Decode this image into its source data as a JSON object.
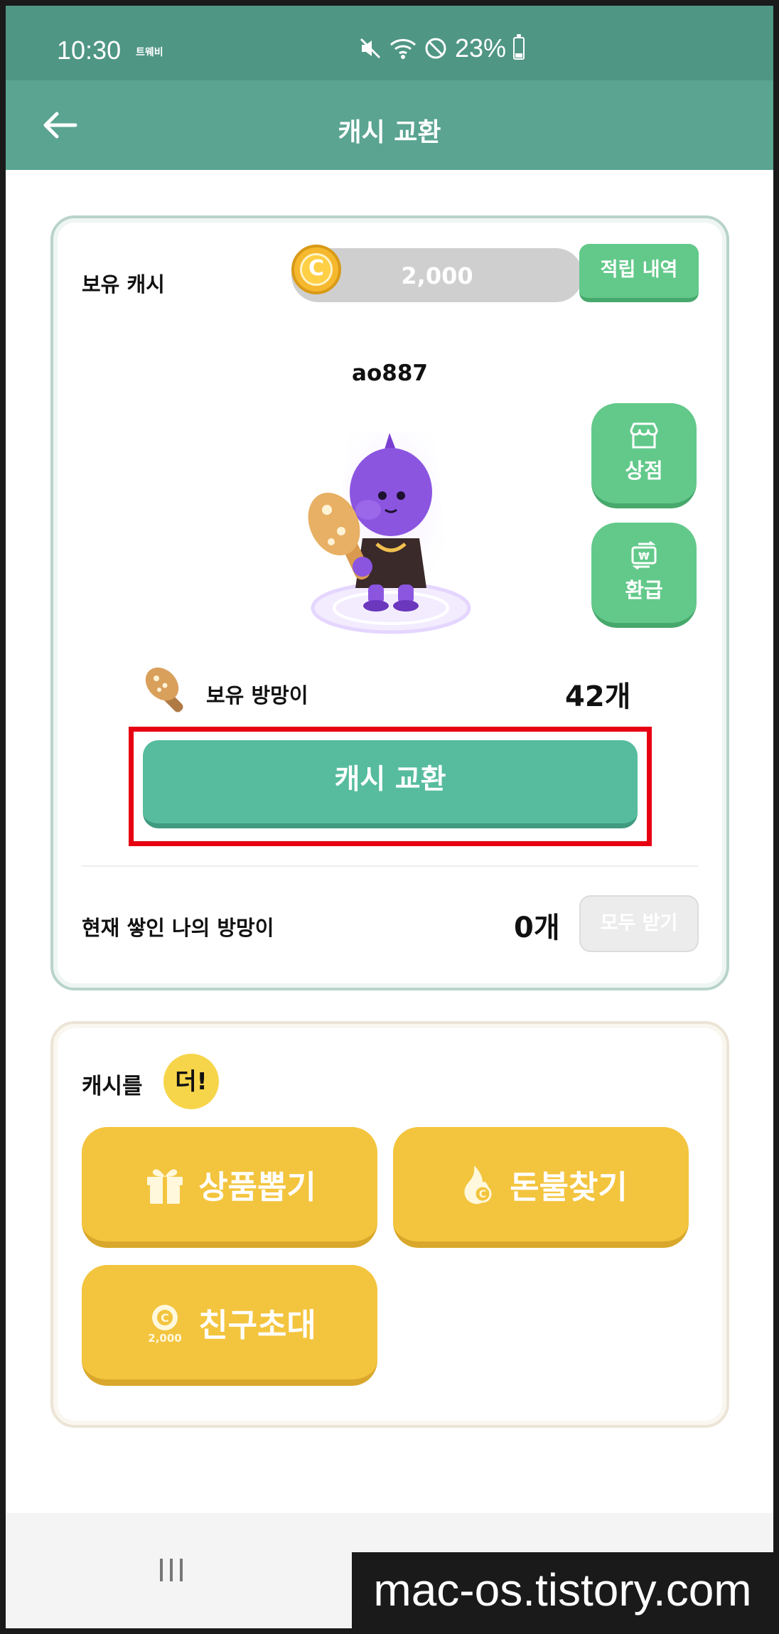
{
  "status_bar": {
    "time": "10:30",
    "carrier": "트웨비",
    "battery": "23%",
    "icons": [
      "mute-icon",
      "wifi-icon",
      "no-disturb-icon",
      "battery-icon"
    ]
  },
  "app_bar": {
    "title": "캐시 교환",
    "back_icon": "arrow-left-icon"
  },
  "balance": {
    "label": "보유 캐시",
    "coin_symbol": "C",
    "value": "2,000",
    "history_button": "적립 내역"
  },
  "profile": {
    "username": "ao887"
  },
  "side_buttons": {
    "shop": "상점",
    "refund": "환급",
    "refund_symbol": "₩"
  },
  "clubs": {
    "label": "보유 방망이",
    "count": "42개"
  },
  "exchange_button": "캐시 교환",
  "stacked": {
    "label": "현재 쌓인 나의 방망이",
    "count": "0개",
    "claim_all_button": "모두 받기"
  },
  "more_cash": {
    "title": "캐시를",
    "badge": "더!",
    "buttons": {
      "prize_draw": "상품뽑기",
      "find_fire": "돈불찾기",
      "invite_friend": "친구초대"
    },
    "invite_coin_amount": "2,000"
  },
  "colors": {
    "status_bar": "#4f9684",
    "app_bar": "#5aa491",
    "green_button": "#62c98a",
    "exchange_button": "#56bc9d",
    "yellow_button": "#f3c43e",
    "highlight": "#e60012"
  },
  "watermark": "mac-os.tistory.com"
}
